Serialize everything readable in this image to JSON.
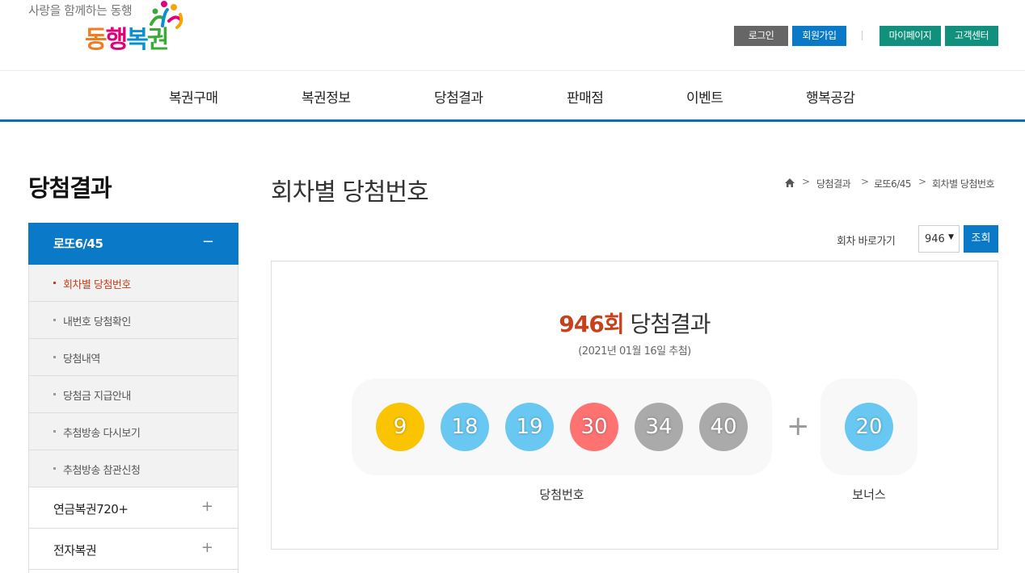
{
  "header": {
    "logo_tagline": "사랑을 함께하는 동행",
    "logo_chars": [
      "동",
      "행",
      "복",
      "권"
    ],
    "util": {
      "login": "로그인",
      "join": "회원가입",
      "mypage": "마이페이지",
      "cs": "고객센터"
    }
  },
  "gnb": [
    "복권구매",
    "복권정보",
    "당첨결과",
    "판매점",
    "이벤트",
    "행복공감"
  ],
  "lnb": {
    "title": "당첨결과",
    "active_category": "로또6/45",
    "active_toggle": "−",
    "subitems": [
      "회차별 당첨번호",
      "내번호 당첨확인",
      "당첨내역",
      "당첨금 지급안내",
      "추첨방송 다시보기",
      "추첨방송 참관신청"
    ],
    "active_subitem_index": 0,
    "categories": [
      {
        "label": "연금복권720+",
        "toggle": "+"
      },
      {
        "label": "전자복권",
        "toggle": "+"
      }
    ]
  },
  "content": {
    "page_title": "회차별 당첨번호",
    "breadcrumb": [
      "당첨결과",
      "로또6/45",
      "회차별 당첨번호"
    ],
    "breadcrumb_sep": ">",
    "draw_select_label": "회차 바로가기",
    "draw_select_value": "946",
    "search_button": "조회",
    "result": {
      "round": "946회",
      "title_suffix": " 당첨결과",
      "date": "(2021년 01월 16일 추첨)",
      "numbers": [
        {
          "value": "9",
          "color": "#fbc400"
        },
        {
          "value": "18",
          "color": "#69c8f2"
        },
        {
          "value": "19",
          "color": "#69c8f2"
        },
        {
          "value": "30",
          "color": "#ff7272"
        },
        {
          "value": "34",
          "color": "#aaaaaa"
        },
        {
          "value": "40",
          "color": "#aaaaaa"
        }
      ],
      "plus": "+",
      "bonus": {
        "value": "20",
        "color": "#69c8f2"
      },
      "label_numbers": "당첨번호",
      "label_bonus": "보너스"
    }
  }
}
